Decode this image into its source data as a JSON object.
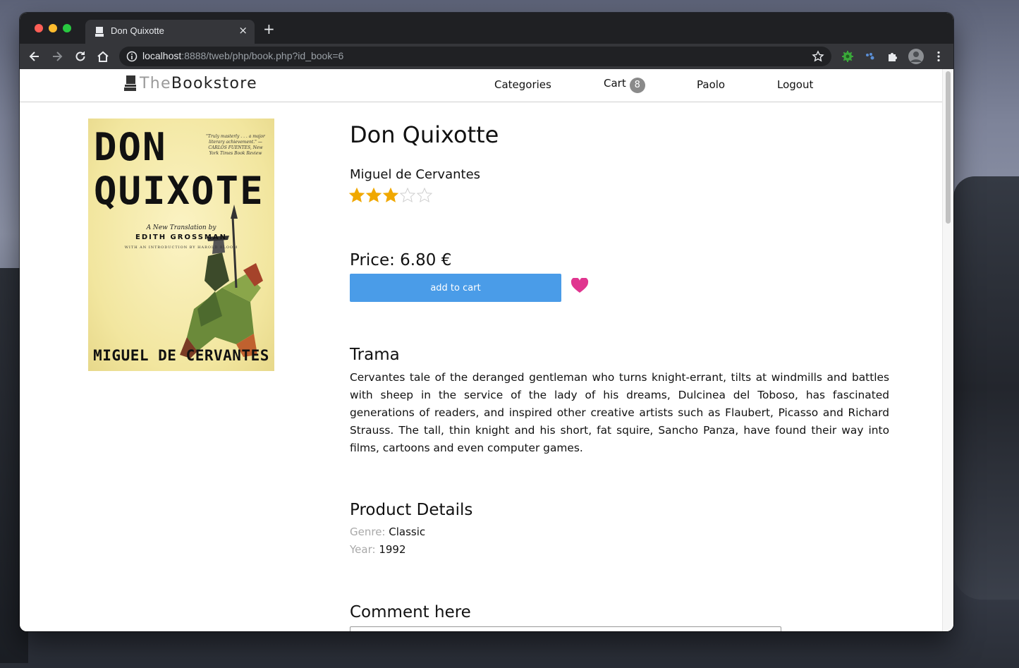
{
  "browser": {
    "tab_title": "Don Quixotte",
    "tab_close": "×",
    "new_tab": "+",
    "url_host": "localhost",
    "url_rest": ":8888/tweb/php/book.php?id_book=6"
  },
  "site": {
    "logo_the": "The",
    "logo_bookstore": "Bookstore",
    "nav": {
      "categories": "Categories",
      "cart": "Cart",
      "cart_count": "8",
      "user": "Paolo",
      "logout": "Logout"
    }
  },
  "cover": {
    "title_line1": "DON",
    "title_line2": "QUIXOTE",
    "blurb": "\"Truly masterly . . . a major literary achievement.\" —CARLOS FUENTES, New York Times Book Review",
    "translation": "A New Translation by",
    "translator": "EDITH GROSSMAN",
    "intro": "WITH AN INTRODUCTION BY HAROLD BLOOM",
    "author": "MIGUEL DE CERVANTES"
  },
  "book": {
    "title": "Don Quixotte",
    "author": "Miguel de Cervantes",
    "rating": 3,
    "rating_max": 5,
    "price": "Price: 6.80 €",
    "add_to_cart": "add to cart",
    "plot_heading": "Trama",
    "plot": "Cervantes tale of the deranged gentleman who turns knight-errant, tilts at windmills and battles with sheep in the service of the lady of his dreams, Dulcinea del Toboso, has fascinated generations of readers, and inspired other creative artists such as Flaubert, Picasso and Richard Strauss. The tall, thin knight and his short, fat squire, Sancho Panza, have found their way into films, cartoons and even computer games.",
    "details_heading": "Product Details",
    "genre_label": "Genre:",
    "genre": "Classic",
    "year_label": "Year:",
    "year": "1992",
    "comment_heading": "Comment here"
  },
  "colors": {
    "accent_button": "#4a9ce8",
    "star_filled": "#f0a800",
    "heart": "#e0358f"
  },
  "icons": [
    "back-icon",
    "forward-icon",
    "reload-icon",
    "home-icon",
    "info-icon",
    "bookmark-star-icon",
    "extension-gear-icon",
    "extension-paw-icon",
    "puzzle-icon",
    "profile-avatar",
    "more-menu-icon",
    "heart-icon"
  ]
}
